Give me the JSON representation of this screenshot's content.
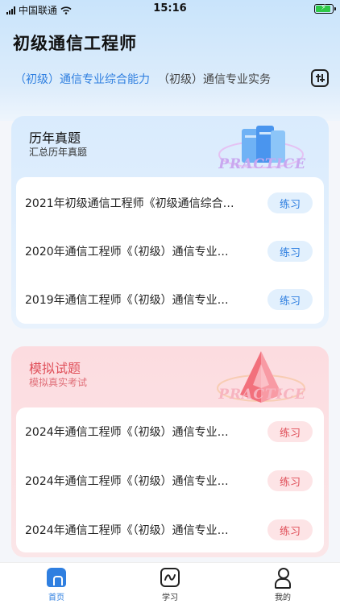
{
  "status": {
    "carrier": "中国联通",
    "time": "15:16"
  },
  "header": {
    "title": "初级通信工程师",
    "tabs": [
      {
        "label": "（初级）通信专业综合能力",
        "active": true
      },
      {
        "label": "（初级）通信专业实务",
        "active": false
      }
    ]
  },
  "sections": [
    {
      "title": "历年真题",
      "subtitle": "汇总历年真题",
      "decoration_text": "PRACTICE",
      "items": [
        {
          "title": "2021年初级通信工程师《初级通信综合…",
          "button": "练习"
        },
        {
          "title": "2020年通信工程师《（初级）通信专业…",
          "button": "练习"
        },
        {
          "title": "2019年通信工程师《（初级）通信专业…",
          "button": "练习"
        }
      ]
    },
    {
      "title": "模拟试题",
      "subtitle": "模拟真实考试",
      "decoration_text": "PRACTICE",
      "items": [
        {
          "title": "2024年通信工程师《（初级）通信专业…",
          "button": "练习"
        },
        {
          "title": "2024年通信工程师《（初级）通信专业…",
          "button": "练习"
        },
        {
          "title": "2024年通信工程师《（初级）通信专业…",
          "button": "练习"
        }
      ]
    }
  ],
  "tabbar": [
    {
      "label": "首页",
      "icon": "home-icon",
      "active": true
    },
    {
      "label": "学习",
      "icon": "study-icon",
      "active": false
    },
    {
      "label": "我的",
      "icon": "profile-icon",
      "active": false
    }
  ],
  "colors": {
    "accent_blue": "#2f7fe0",
    "accent_red": "#e0505a"
  }
}
